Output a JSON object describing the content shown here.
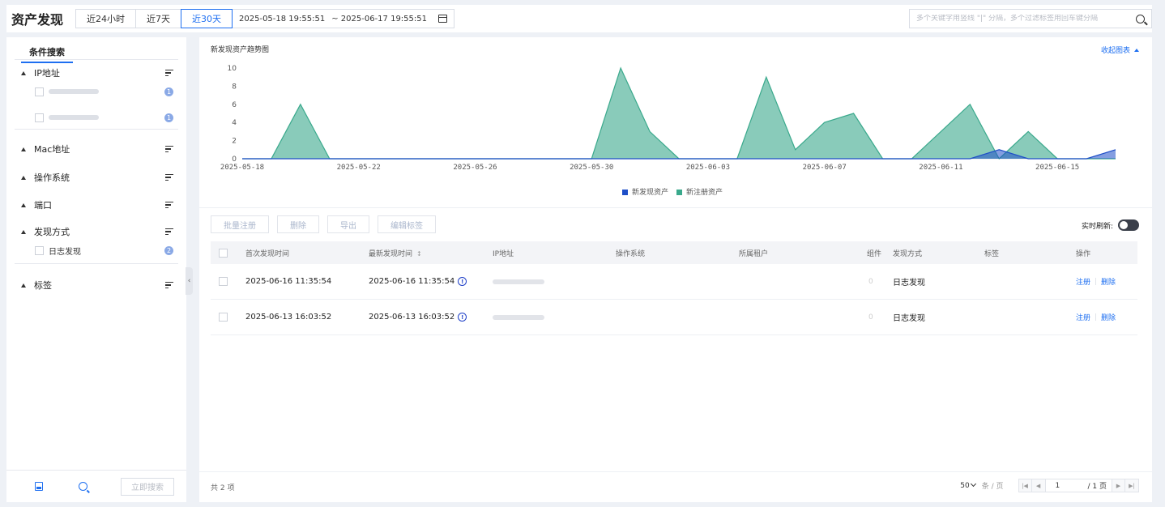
{
  "header": {
    "title": "资产发现",
    "ranges": [
      "近24小时",
      "近7天",
      "近30天"
    ],
    "active_range": "近30天",
    "date_start": "2025-05-18 19:55:51",
    "date_end": "~ 2025-06-17 19:55:51",
    "search_placeholder": "多个关键字用竖线 \"|\" 分隔，多个过滤标签用回车键分隔"
  },
  "sidebar": {
    "tab": "条件搜索",
    "groups": [
      {
        "label": "IP地址",
        "options": [
          {
            "label": "",
            "count": "1"
          },
          {
            "label": "",
            "count": "1"
          }
        ]
      },
      {
        "label": "Mac地址",
        "options": []
      },
      {
        "label": "操作系统",
        "options": []
      },
      {
        "label": "端口",
        "options": []
      },
      {
        "label": "发现方式",
        "options": [
          {
            "label": "日志发现",
            "count": "2"
          }
        ]
      },
      {
        "label": "标签",
        "options": []
      }
    ],
    "search_button": "立即搜索"
  },
  "chart_section": {
    "title": "新发现资产趋势图",
    "collapse_label": "收起图表"
  },
  "chart_data": {
    "type": "area",
    "title": "新发现资产趋势图",
    "x": [
      "2025-05-18",
      "2025-05-19",
      "2025-05-20",
      "2025-05-21",
      "2025-05-22",
      "2025-05-23",
      "2025-05-24",
      "2025-05-25",
      "2025-05-26",
      "2025-05-27",
      "2025-05-28",
      "2025-05-29",
      "2025-05-30",
      "2025-05-31",
      "2025-06-01",
      "2025-06-02",
      "2025-06-03",
      "2025-06-04",
      "2025-06-05",
      "2025-06-06",
      "2025-06-07",
      "2025-06-08",
      "2025-06-09",
      "2025-06-10",
      "2025-06-11",
      "2025-06-12",
      "2025-06-13",
      "2025-06-14",
      "2025-06-15",
      "2025-06-16",
      "2025-06-17"
    ],
    "x_ticks": [
      "2025-05-18",
      "2025-05-22",
      "2025-05-26",
      "2025-05-30",
      "2025-06-03",
      "2025-06-07",
      "2025-06-11",
      "2025-06-15"
    ],
    "y_ticks": [
      0,
      2,
      4,
      6,
      8,
      10
    ],
    "ylim": [
      0,
      10
    ],
    "series": [
      {
        "name": "新发现资产",
        "color": "#1f4fc8",
        "values": [
          0,
          0,
          0,
          0,
          0,
          0,
          0,
          0,
          0,
          0,
          0,
          0,
          0,
          0,
          0,
          0,
          0,
          0,
          0,
          0,
          0,
          0,
          0,
          0,
          0,
          0,
          1,
          0,
          0,
          0,
          1,
          0
        ]
      },
      {
        "name": "新注册资产",
        "color": "#3aa98c",
        "values": [
          0,
          0,
          6,
          0,
          0,
          0,
          0,
          0,
          0,
          0,
          0,
          0,
          0,
          10,
          3,
          0,
          0,
          0,
          9,
          1,
          4,
          5,
          0,
          0,
          3,
          6,
          0,
          3,
          0,
          0,
          0,
          2,
          0
        ]
      }
    ],
    "legend_position": "bottom"
  },
  "toolbar": {
    "buttons": [
      "批量注册",
      "删除",
      "导出",
      "编辑标签"
    ],
    "realtime_label": "实时刷新:"
  },
  "table": {
    "columns": [
      "首次发现时间",
      "最新发现时间",
      "IP地址",
      "操作系统",
      "所属租户",
      "组件",
      "发现方式",
      "标签",
      "操作"
    ],
    "rows": [
      {
        "first": "2025-06-16 11:35:54",
        "last": "2025-06-16 11:35:54",
        "ip": "",
        "os": "",
        "tenant": "",
        "components": "0",
        "method": "日志发现",
        "tags": "",
        "actions": [
          "注册",
          "删除"
        ]
      },
      {
        "first": "2025-06-13 16:03:52",
        "last": "2025-06-13 16:03:52",
        "ip": "",
        "os": "",
        "tenant": "",
        "components": "0",
        "method": "日志发现",
        "tags": "",
        "actions": [
          "注册",
          "删除"
        ]
      }
    ]
  },
  "footer": {
    "total": "共 2 项",
    "page_size": "50",
    "page_size_unit": "条 / 页",
    "current_page": "1",
    "total_pages": "/ 1 页"
  }
}
